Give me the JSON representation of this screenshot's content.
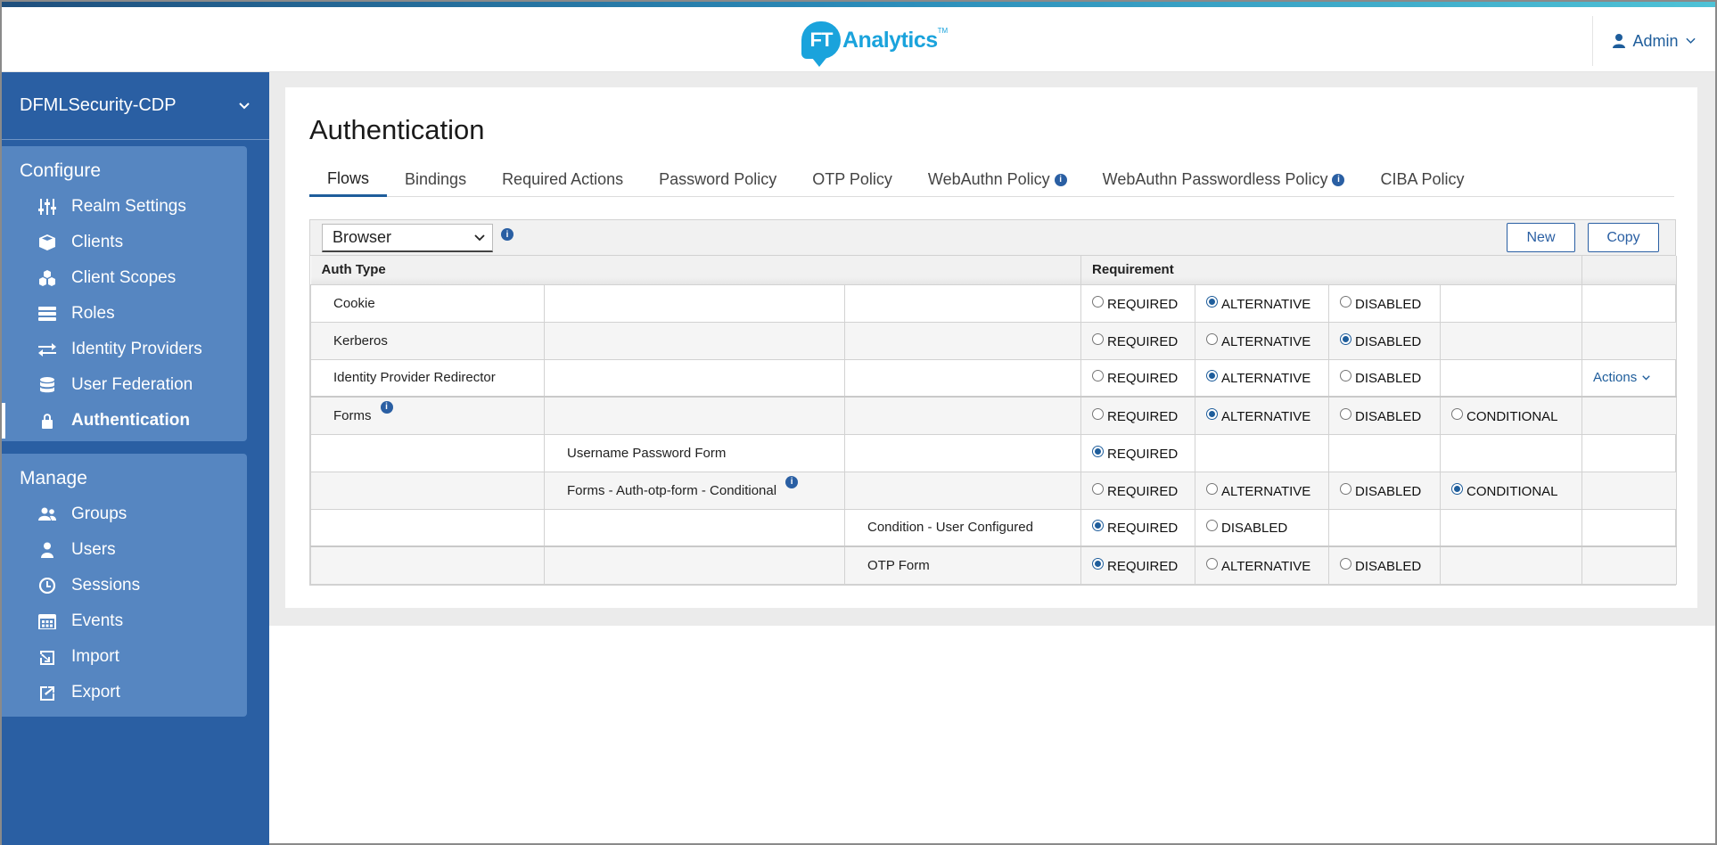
{
  "header": {
    "logo_mark": "FT",
    "logo_text": "Analytics",
    "logo_tm": "TM",
    "user": "Admin"
  },
  "sidebar": {
    "realm": "DFMLSecurity-CDP",
    "configure_title": "Configure",
    "configure_items": [
      {
        "label": "Realm Settings",
        "icon": "sliders-icon"
      },
      {
        "label": "Clients",
        "icon": "cube-icon"
      },
      {
        "label": "Client Scopes",
        "icon": "cubes-icon"
      },
      {
        "label": "Roles",
        "icon": "list-icon"
      },
      {
        "label": "Identity Providers",
        "icon": "exchange-icon"
      },
      {
        "label": "User Federation",
        "icon": "database-icon"
      },
      {
        "label": "Authentication",
        "icon": "lock-icon"
      }
    ],
    "manage_title": "Manage",
    "manage_items": [
      {
        "label": "Groups",
        "icon": "users-icon"
      },
      {
        "label": "Users",
        "icon": "user-icon"
      },
      {
        "label": "Sessions",
        "icon": "clock-icon"
      },
      {
        "label": "Events",
        "icon": "calendar-icon"
      },
      {
        "label": "Import",
        "icon": "import-icon"
      },
      {
        "label": "Export",
        "icon": "export-icon"
      }
    ]
  },
  "main": {
    "title": "Authentication",
    "tabs": [
      "Flows",
      "Bindings",
      "Required Actions",
      "Password Policy",
      "OTP Policy",
      "WebAuthn Policy",
      "WebAuthn Passwordless Policy",
      "CIBA Policy"
    ],
    "flow_select": "Browser",
    "new_button": "New",
    "copy_button": "Copy",
    "columns": {
      "auth_type": "Auth Type",
      "requirement": "Requirement"
    },
    "rows": [
      {
        "l1": "Cookie",
        "l2": "",
        "l3": "",
        "options": [
          "REQUIRED",
          "ALTERNATIVE",
          "DISABLED"
        ],
        "selected": 1,
        "actions": ""
      },
      {
        "l1": "Kerberos",
        "l2": "",
        "l3": "",
        "options": [
          "REQUIRED",
          "ALTERNATIVE",
          "DISABLED"
        ],
        "selected": 2,
        "actions": ""
      },
      {
        "l1": "Identity Provider Redirector",
        "l2": "",
        "l3": "",
        "options": [
          "REQUIRED",
          "ALTERNATIVE",
          "DISABLED"
        ],
        "selected": 1,
        "actions": "Actions"
      },
      {
        "l1": "Forms",
        "l2": "",
        "l3": "",
        "options": [
          "REQUIRED",
          "ALTERNATIVE",
          "DISABLED",
          "CONDITIONAL"
        ],
        "selected": 1,
        "actions": ""
      },
      {
        "l1": "",
        "l2": "Username Password Form",
        "l3": "",
        "options": [
          "REQUIRED"
        ],
        "selected": 0,
        "actions": ""
      },
      {
        "l1": "",
        "l2": "Forms - Auth-otp-form - Conditional",
        "l3": "",
        "options": [
          "REQUIRED",
          "ALTERNATIVE",
          "DISABLED",
          "CONDITIONAL"
        ],
        "selected": 3,
        "actions": ""
      },
      {
        "l1": "",
        "l2": "",
        "l3": "Condition - User Configured",
        "options": [
          "REQUIRED",
          "DISABLED"
        ],
        "selected": 0,
        "actions": ""
      },
      {
        "l1": "",
        "l2": "",
        "l3": "OTP Form",
        "options": [
          "REQUIRED",
          "ALTERNATIVE",
          "DISABLED"
        ],
        "selected": 0,
        "actions": ""
      }
    ]
  }
}
